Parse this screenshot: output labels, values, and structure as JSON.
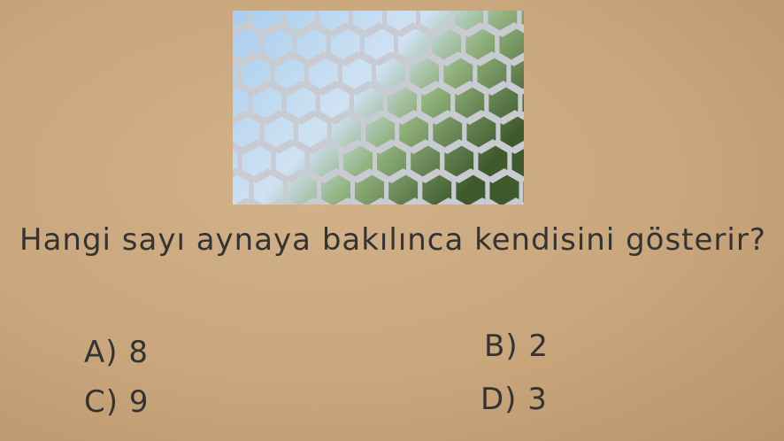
{
  "question": "Hangi sayı aynaya bakılınca kendisini gösterir?",
  "options": [
    {
      "letter": "A)",
      "value": "8"
    },
    {
      "letter": "B)",
      "value": "2"
    },
    {
      "letter": "C)",
      "value": "9"
    },
    {
      "letter": "D)",
      "value": "3"
    }
  ],
  "colors": {
    "background": "#c9a67c",
    "text": "#333333"
  }
}
